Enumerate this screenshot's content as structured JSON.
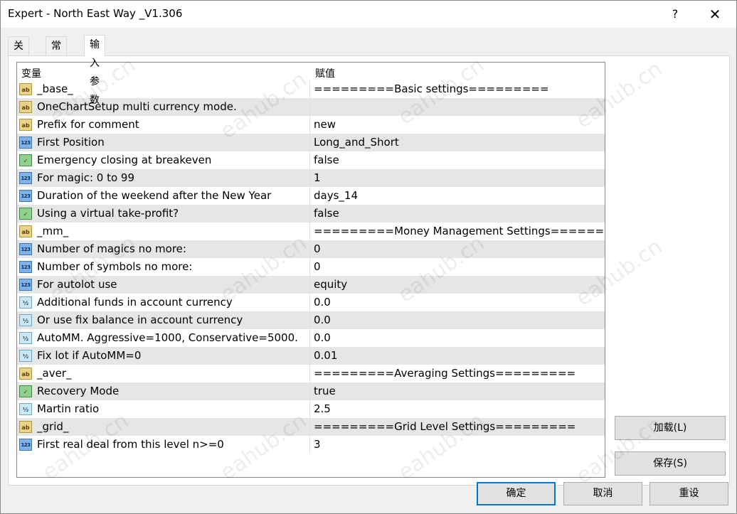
{
  "window": {
    "title": "Expert - North East Way _V1.306",
    "help_label": "?",
    "close_label": "✕"
  },
  "tabs": [
    {
      "label": "关于"
    },
    {
      "label": "常用"
    },
    {
      "label": "输入参数",
      "active": true
    }
  ],
  "table": {
    "headers": [
      "变量",
      "赋值"
    ],
    "rows": [
      {
        "type": "string",
        "icon": "ab",
        "name": "_base_",
        "value": "=========Basic settings========="
      },
      {
        "type": "string",
        "icon": "ab",
        "name": "OneChartSetup multi currency mode.",
        "value": ""
      },
      {
        "type": "string",
        "icon": "ab",
        "name": "Prefix for comment",
        "value": "new"
      },
      {
        "type": "int",
        "icon": "123",
        "name": "First Position",
        "value": "Long_and_Short"
      },
      {
        "type": "bool",
        "icon": "✓",
        "name": "Emergency closing at breakeven",
        "value": "false"
      },
      {
        "type": "int",
        "icon": "123",
        "name": "For magic: 0 to 99",
        "value": "1"
      },
      {
        "type": "int",
        "icon": "123",
        "name": "Duration of the weekend after the New Year",
        "value": "days_14"
      },
      {
        "type": "bool",
        "icon": "✓",
        "name": "Using a virtual take-profit?",
        "value": "false"
      },
      {
        "type": "string",
        "icon": "ab",
        "name": "_mm_",
        "value": "=========Money Management Settings======..."
      },
      {
        "type": "int",
        "icon": "123",
        "name": "Number of magics no more:",
        "value": "0"
      },
      {
        "type": "int",
        "icon": "123",
        "name": "Number of symbols no more:",
        "value": "0"
      },
      {
        "type": "int",
        "icon": "123",
        "name": "For autolot use",
        "value": "equity"
      },
      {
        "type": "double",
        "icon": "½",
        "name": "Additional funds in account currency",
        "value": "0.0"
      },
      {
        "type": "double",
        "icon": "½",
        "name": "Or use fix balance in account currency",
        "value": "0.0"
      },
      {
        "type": "double",
        "icon": "½",
        "name": "AutoMM. Aggressive=1000, Conservative=5000.",
        "value": "0.0"
      },
      {
        "type": "double",
        "icon": "½",
        "name": "Fix lot if AutoMM=0",
        "value": "0.01"
      },
      {
        "type": "string",
        "icon": "ab",
        "name": "_aver_",
        "value": "=========Averaging Settings========="
      },
      {
        "type": "bool",
        "icon": "✓",
        "name": "Recovery Mode",
        "value": "true"
      },
      {
        "type": "double",
        "icon": "½",
        "name": "Martin ratio",
        "value": "2.5"
      },
      {
        "type": "string",
        "icon": "ab",
        "name": "_grid_",
        "value": "=========Grid Level Settings========="
      },
      {
        "type": "int",
        "icon": "123",
        "name": "First real deal from this level n>=0",
        "value": "3"
      }
    ]
  },
  "side_buttons": {
    "load_label": "加载(L)",
    "save_label": "保存(S)"
  },
  "bottom_buttons": {
    "ok_label": "确定",
    "cancel_label": "取消",
    "reset_label": "重设"
  },
  "watermark": "eahub.cn"
}
